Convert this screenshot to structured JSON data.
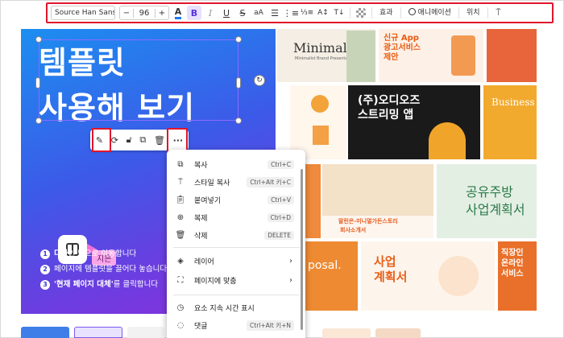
{
  "toolbar": {
    "font_name": "Source Han Sans ...",
    "font_size": "96",
    "minus": "−",
    "plus": "+",
    "effects_label": "효과",
    "animate_label": "애니메이션",
    "position_label": "위치"
  },
  "canvas": {
    "title_line1": "템플릿",
    "title_line2": "사용해 보기",
    "tag_label": "지은",
    "steps": [
      {
        "num": "1",
        "bold": "디자인",
        "text": " 탭으로 이동합니다"
      },
      {
        "num": "2",
        "bold": "",
        "text": "페이지에 템플릿을 끌어다 놓습니다"
      },
      {
        "num": "3",
        "bold": "'현재 페이지 대체'",
        "text": "를 클릭합니다"
      }
    ]
  },
  "templates": {
    "minimalist": "Minimalist",
    "minimalist_sub": "Minimalist Brand Presentation",
    "app_ad_line1": "신규 App",
    "app_ad_line2": "광고서비스",
    "app_ad_line3": "제안",
    "streaming_line1": "(주)오디오즈",
    "streaming_line2": "스트리밍 앱",
    "business": "Business",
    "garden_intro": "말린은-미니멀가든스토리",
    "garden_intro2": "회사소개서",
    "coexist_line1": "공유주방",
    "coexist_line2": "사업계획서",
    "proposal": "posal.",
    "biz_plan_line1": "사업",
    "biz_plan_line2": "계획서",
    "online_line1": "직장인",
    "online_line2": "온라인",
    "online_line3": "서비스"
  },
  "context_menu": {
    "items": [
      {
        "icon": "copy-icon",
        "label": "복사",
        "shortcut": "Ctrl+C"
      },
      {
        "icon": "paint-roller-icon",
        "label": "스타일 복사",
        "shortcut": "Ctrl+Alt 키+C"
      },
      {
        "icon": "paste-icon",
        "label": "붙여넣기",
        "shortcut": "Ctrl+V"
      },
      {
        "icon": "duplicate-icon",
        "label": "복제",
        "shortcut": "Ctrl+D"
      },
      {
        "icon": "trash-icon",
        "label": "삭제",
        "shortcut": "DELETE"
      },
      {
        "icon": "layers-icon",
        "label": "레이어",
        "shortcut": ""
      },
      {
        "icon": "fit-page-icon",
        "label": "페이지에 맞춤",
        "shortcut": ""
      },
      {
        "icon": "clock-icon",
        "label": "요소 지속 시간 표시",
        "shortcut": ""
      },
      {
        "icon": "comment-icon",
        "label": "댓글",
        "shortcut": "Ctrl+Alt 키+N"
      }
    ]
  },
  "colors": {
    "highlight_red": "#e0162b",
    "accent_purple": "#8b6bff"
  }
}
